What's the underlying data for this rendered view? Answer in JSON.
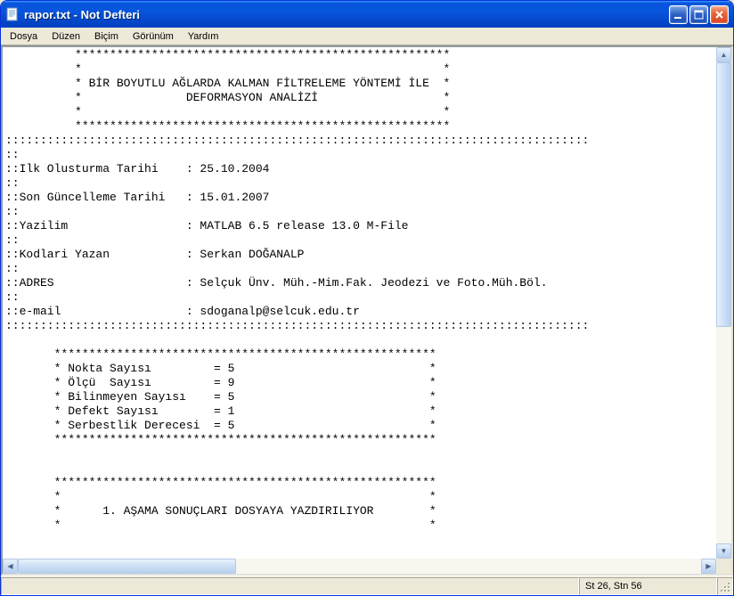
{
  "window": {
    "title": "rapor.txt - Not Defteri"
  },
  "menu": {
    "file": "Dosya",
    "edit": "Düzen",
    "format": "Biçim",
    "view": "Görünüm",
    "help": "Yardım"
  },
  "content": {
    "text": "          ******************************************************\n          *                                                    *\n          * BİR BOYUTLU AĞLARDA KALMAN FİLTRELEME YÖNTEMİ İLE  *\n          *               DEFORMASYON ANALİZİ                  *\n          *                                                    *\n          ******************************************************\n::::::::::::::::::::::::::::::::::::::::::::::::::::::::::::::::::::::::::::::::::::\n::\n::Ilk Olusturma Tarihi    : 25.10.2004\n::\n::Son Güncelleme Tarihi   : 15.01.2007\n::\n::Yazilim                 : MATLAB 6.5 release 13.0 M-File\n::\n::Kodlari Yazan           : Serkan DOĞANALP\n::\n::ADRES                   : Selçuk Ünv. Müh.-Mim.Fak. Jeodezi ve Foto.Müh.Böl.\n::\n::e-mail                  : sdoganalp@selcuk.edu.tr\n::::::::::::::::::::::::::::::::::::::::::::::::::::::::::::::::::::::::::::::::::::\n\n       *******************************************************\n       * Nokta Sayısı         = 5                            *\n       * Ölçü  Sayısı         = 9                            *\n       * Bilinmeyen Sayısı    = 5                            *\n       * Defekt Sayısı        = 1                            *\n       * Serbestlik Derecesi  = 5                            *\n       *******************************************************\n\n\n       *******************************************************\n       *                                                     *\n       *      1. AŞAMA SONUÇLARI DOSYAYA YAZDIRILIYOR        *\n       *                                                     *"
  },
  "status": {
    "position": "St 26, Stn 56"
  },
  "report_data": {
    "header": {
      "title_line1": "BİR BOYUTLU AĞLARDA KALMAN FİLTRELEME YÖNTEMİ İLE",
      "title_line2": "DEFORMASYON ANALİZİ"
    },
    "meta": {
      "ilk_olusturma_tarihi": "25.10.2004",
      "son_guncelleme_tarihi": "15.01.2007",
      "yazilim": "MATLAB 6.5 release 13.0 M-File",
      "kodlari_yazan": "Serkan DOĞANALP",
      "adres": "Selçuk Ünv. Müh.-Mim.Fak. Jeodezi ve Foto.Müh.Böl.",
      "email": "sdoganalp@selcuk.edu.tr"
    },
    "stats": {
      "nokta_sayisi": 5,
      "olcu_sayisi": 9,
      "bilinmeyen_sayisi": 5,
      "defekt_sayisi": 1,
      "serbestlik_derecesi": 5
    },
    "section_heading": "1. AŞAMA SONUÇLARI DOSYAYA YAZDIRILIYOR"
  }
}
